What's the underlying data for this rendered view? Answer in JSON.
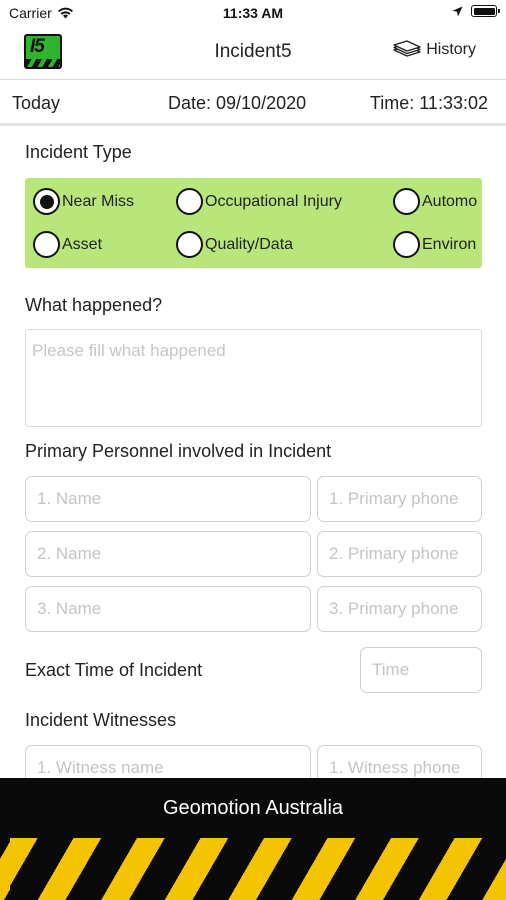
{
  "status_bar": {
    "carrier": "Carrier",
    "time": "11:33 AM"
  },
  "nav": {
    "logo_text": "I5",
    "title": "Incident5",
    "history_label": "History"
  },
  "date_row": {
    "today": "Today",
    "date": "Date: 09/10/2020",
    "time": "Time: 11:33:02"
  },
  "incident_type": {
    "label": "Incident Type",
    "options": [
      "Near Miss",
      "Occupational Injury",
      "Automo",
      "Asset",
      "Quality/Data",
      "Environ"
    ],
    "selected": "Near Miss",
    "box_color": "#b9e67a"
  },
  "what_happened": {
    "label": "What happened?",
    "placeholder": "Please fill what happened"
  },
  "personnel": {
    "label": "Primary Personnel involved in Incident",
    "name_placeholders": [
      "1. Name",
      "2. Name",
      "3. Name"
    ],
    "phone_placeholders": [
      "1. Primary phone",
      "2. Primary phone",
      "3. Primary phone"
    ]
  },
  "exact_time": {
    "label": "Exact Time of Incident",
    "placeholder": "Time"
  },
  "witnesses": {
    "label": "Incident Witnesses",
    "name_placeholder": "1. Witness name",
    "phone_placeholder": "1. Witness phone"
  },
  "footer": {
    "company": "Geomotion Australia",
    "stripe_colors": [
      "#f5c400",
      "#0a0a0a"
    ]
  }
}
